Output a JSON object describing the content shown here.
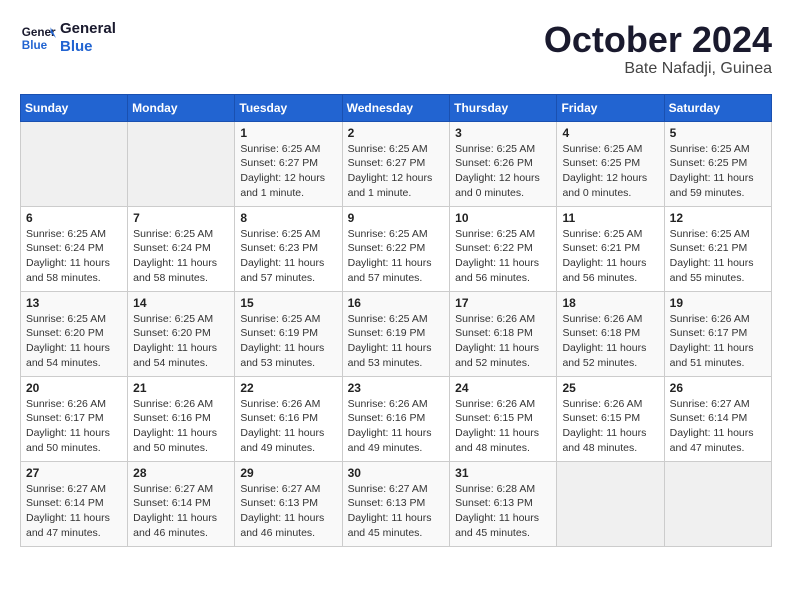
{
  "header": {
    "logo_line1": "General",
    "logo_line2": "Blue",
    "month": "October 2024",
    "location": "Bate Nafadji, Guinea"
  },
  "weekdays": [
    "Sunday",
    "Monday",
    "Tuesday",
    "Wednesday",
    "Thursday",
    "Friday",
    "Saturday"
  ],
  "weeks": [
    [
      {
        "day": "",
        "info": ""
      },
      {
        "day": "",
        "info": ""
      },
      {
        "day": "1",
        "info": "Sunrise: 6:25 AM\nSunset: 6:27 PM\nDaylight: 12 hours\nand 1 minute."
      },
      {
        "day": "2",
        "info": "Sunrise: 6:25 AM\nSunset: 6:27 PM\nDaylight: 12 hours\nand 1 minute."
      },
      {
        "day": "3",
        "info": "Sunrise: 6:25 AM\nSunset: 6:26 PM\nDaylight: 12 hours\nand 0 minutes."
      },
      {
        "day": "4",
        "info": "Sunrise: 6:25 AM\nSunset: 6:25 PM\nDaylight: 12 hours\nand 0 minutes."
      },
      {
        "day": "5",
        "info": "Sunrise: 6:25 AM\nSunset: 6:25 PM\nDaylight: 11 hours\nand 59 minutes."
      }
    ],
    [
      {
        "day": "6",
        "info": "Sunrise: 6:25 AM\nSunset: 6:24 PM\nDaylight: 11 hours\nand 58 minutes."
      },
      {
        "day": "7",
        "info": "Sunrise: 6:25 AM\nSunset: 6:24 PM\nDaylight: 11 hours\nand 58 minutes."
      },
      {
        "day": "8",
        "info": "Sunrise: 6:25 AM\nSunset: 6:23 PM\nDaylight: 11 hours\nand 57 minutes."
      },
      {
        "day": "9",
        "info": "Sunrise: 6:25 AM\nSunset: 6:22 PM\nDaylight: 11 hours\nand 57 minutes."
      },
      {
        "day": "10",
        "info": "Sunrise: 6:25 AM\nSunset: 6:22 PM\nDaylight: 11 hours\nand 56 minutes."
      },
      {
        "day": "11",
        "info": "Sunrise: 6:25 AM\nSunset: 6:21 PM\nDaylight: 11 hours\nand 56 minutes."
      },
      {
        "day": "12",
        "info": "Sunrise: 6:25 AM\nSunset: 6:21 PM\nDaylight: 11 hours\nand 55 minutes."
      }
    ],
    [
      {
        "day": "13",
        "info": "Sunrise: 6:25 AM\nSunset: 6:20 PM\nDaylight: 11 hours\nand 54 minutes."
      },
      {
        "day": "14",
        "info": "Sunrise: 6:25 AM\nSunset: 6:20 PM\nDaylight: 11 hours\nand 54 minutes."
      },
      {
        "day": "15",
        "info": "Sunrise: 6:25 AM\nSunset: 6:19 PM\nDaylight: 11 hours\nand 53 minutes."
      },
      {
        "day": "16",
        "info": "Sunrise: 6:25 AM\nSunset: 6:19 PM\nDaylight: 11 hours\nand 53 minutes."
      },
      {
        "day": "17",
        "info": "Sunrise: 6:26 AM\nSunset: 6:18 PM\nDaylight: 11 hours\nand 52 minutes."
      },
      {
        "day": "18",
        "info": "Sunrise: 6:26 AM\nSunset: 6:18 PM\nDaylight: 11 hours\nand 52 minutes."
      },
      {
        "day": "19",
        "info": "Sunrise: 6:26 AM\nSunset: 6:17 PM\nDaylight: 11 hours\nand 51 minutes."
      }
    ],
    [
      {
        "day": "20",
        "info": "Sunrise: 6:26 AM\nSunset: 6:17 PM\nDaylight: 11 hours\nand 50 minutes."
      },
      {
        "day": "21",
        "info": "Sunrise: 6:26 AM\nSunset: 6:16 PM\nDaylight: 11 hours\nand 50 minutes."
      },
      {
        "day": "22",
        "info": "Sunrise: 6:26 AM\nSunset: 6:16 PM\nDaylight: 11 hours\nand 49 minutes."
      },
      {
        "day": "23",
        "info": "Sunrise: 6:26 AM\nSunset: 6:16 PM\nDaylight: 11 hours\nand 49 minutes."
      },
      {
        "day": "24",
        "info": "Sunrise: 6:26 AM\nSunset: 6:15 PM\nDaylight: 11 hours\nand 48 minutes."
      },
      {
        "day": "25",
        "info": "Sunrise: 6:26 AM\nSunset: 6:15 PM\nDaylight: 11 hours\nand 48 minutes."
      },
      {
        "day": "26",
        "info": "Sunrise: 6:27 AM\nSunset: 6:14 PM\nDaylight: 11 hours\nand 47 minutes."
      }
    ],
    [
      {
        "day": "27",
        "info": "Sunrise: 6:27 AM\nSunset: 6:14 PM\nDaylight: 11 hours\nand 47 minutes."
      },
      {
        "day": "28",
        "info": "Sunrise: 6:27 AM\nSunset: 6:14 PM\nDaylight: 11 hours\nand 46 minutes."
      },
      {
        "day": "29",
        "info": "Sunrise: 6:27 AM\nSunset: 6:13 PM\nDaylight: 11 hours\nand 46 minutes."
      },
      {
        "day": "30",
        "info": "Sunrise: 6:27 AM\nSunset: 6:13 PM\nDaylight: 11 hours\nand 45 minutes."
      },
      {
        "day": "31",
        "info": "Sunrise: 6:28 AM\nSunset: 6:13 PM\nDaylight: 11 hours\nand 45 minutes."
      },
      {
        "day": "",
        "info": ""
      },
      {
        "day": "",
        "info": ""
      }
    ]
  ]
}
